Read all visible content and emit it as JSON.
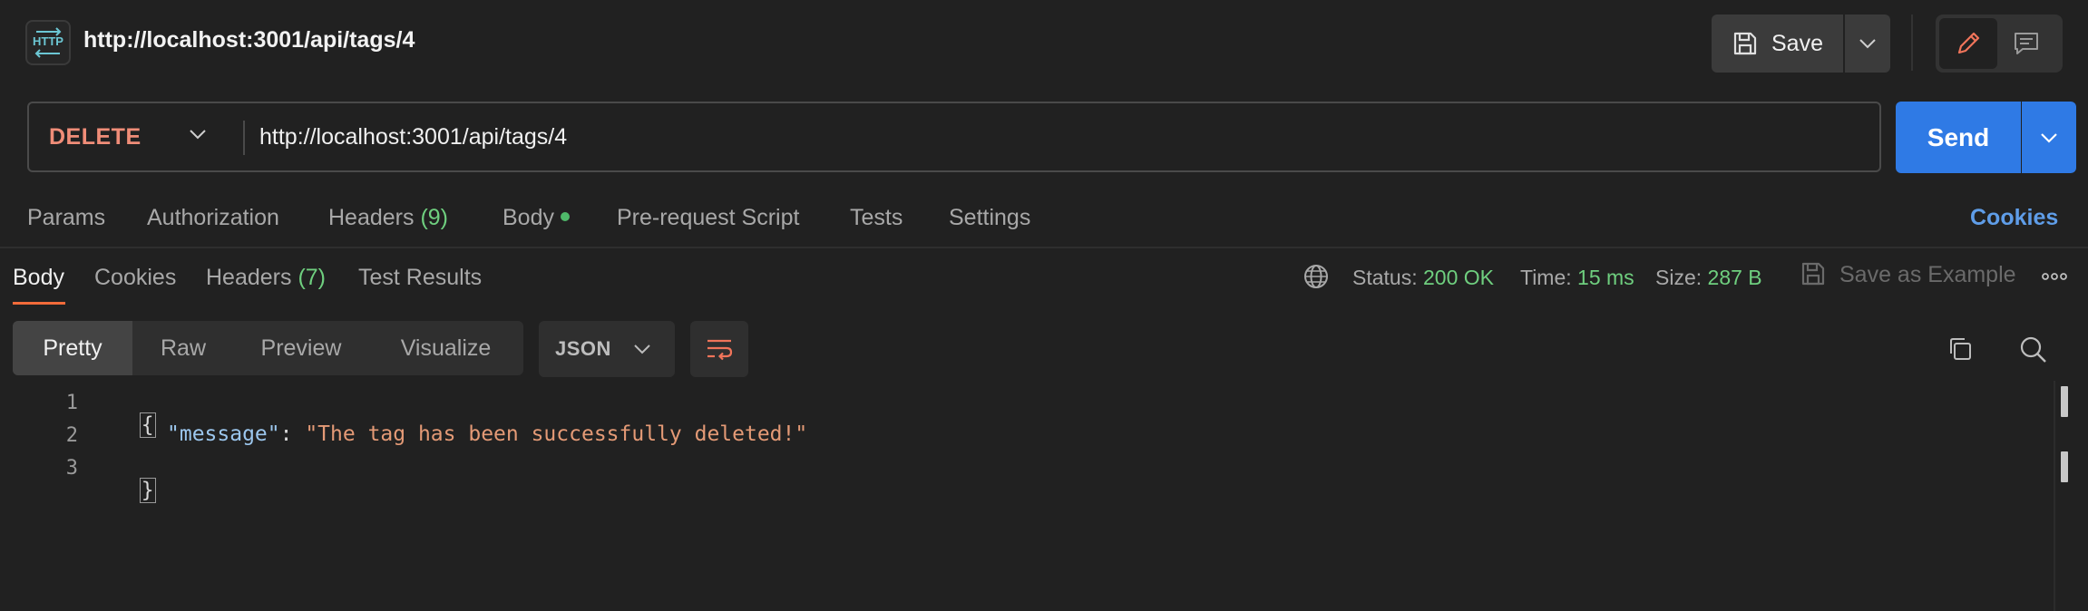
{
  "request": {
    "badge_text": "HTTP",
    "title": "http://localhost:3001/api/tags/4",
    "method": "DELETE",
    "url": "http://localhost:3001/api/tags/4"
  },
  "toolbar": {
    "save_label": "Save",
    "send_label": "Send"
  },
  "request_tabs": {
    "params": "Params",
    "authorization": "Authorization",
    "headers": "Headers",
    "headers_count": "(9)",
    "body": "Body",
    "pre_request": "Pre-request Script",
    "tests": "Tests",
    "settings": "Settings",
    "cookies": "Cookies"
  },
  "response_tabs": {
    "body": "Body",
    "cookies": "Cookies",
    "headers": "Headers",
    "headers_count": "(7)",
    "test_results": "Test Results"
  },
  "response_meta": {
    "status_label": "Status:",
    "status_value": "200 OK",
    "time_label": "Time:",
    "time_value": "15 ms",
    "size_label": "Size:",
    "size_value": "287 B",
    "save_example": "Save as Example"
  },
  "view_modes": {
    "pretty": "Pretty",
    "raw": "Raw",
    "preview": "Preview",
    "visualize": "Visualize",
    "format": "JSON"
  },
  "code": {
    "line1": "1",
    "line2": "2",
    "line3": "3",
    "open_brace": "{",
    "close_brace": "}",
    "key": "\"message\"",
    "colon": ": ",
    "value": "\"The tag has been successfully deleted!\""
  },
  "colors": {
    "accent_send": "#2f7ae5",
    "method_delete": "#f08d78",
    "status_ok": "#6fcf7f",
    "active_tab_underline": "#f26b3a"
  }
}
